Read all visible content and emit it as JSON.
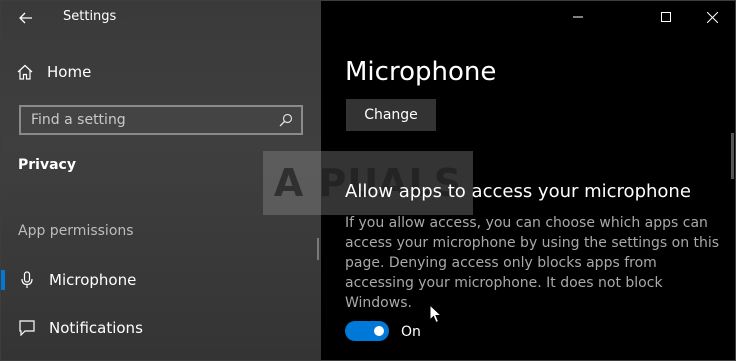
{
  "window": {
    "title": "Settings"
  },
  "sidebar": {
    "home_label": "Home",
    "search_placeholder": "Find a setting",
    "category": "Privacy",
    "section_label": "App permissions",
    "items": [
      {
        "label": "Microphone",
        "icon": "microphone-icon",
        "selected": true
      },
      {
        "label": "Notifications",
        "icon": "notifications-icon",
        "selected": false
      }
    ]
  },
  "main": {
    "title": "Microphone",
    "change_label": "Change",
    "section_title": "Allow apps to access your microphone",
    "description": "If you allow access, you can choose which apps can access your microphone by using the settings on this page. Denying access only blocks apps from accessing your microphone. It does not block Windows.",
    "toggle": {
      "state": "On",
      "on": true
    }
  },
  "watermark": "A PUALS",
  "colors": {
    "accent": "#0078d7",
    "sidebar_bg": "#3c3c3c",
    "main_bg": "#000000"
  }
}
